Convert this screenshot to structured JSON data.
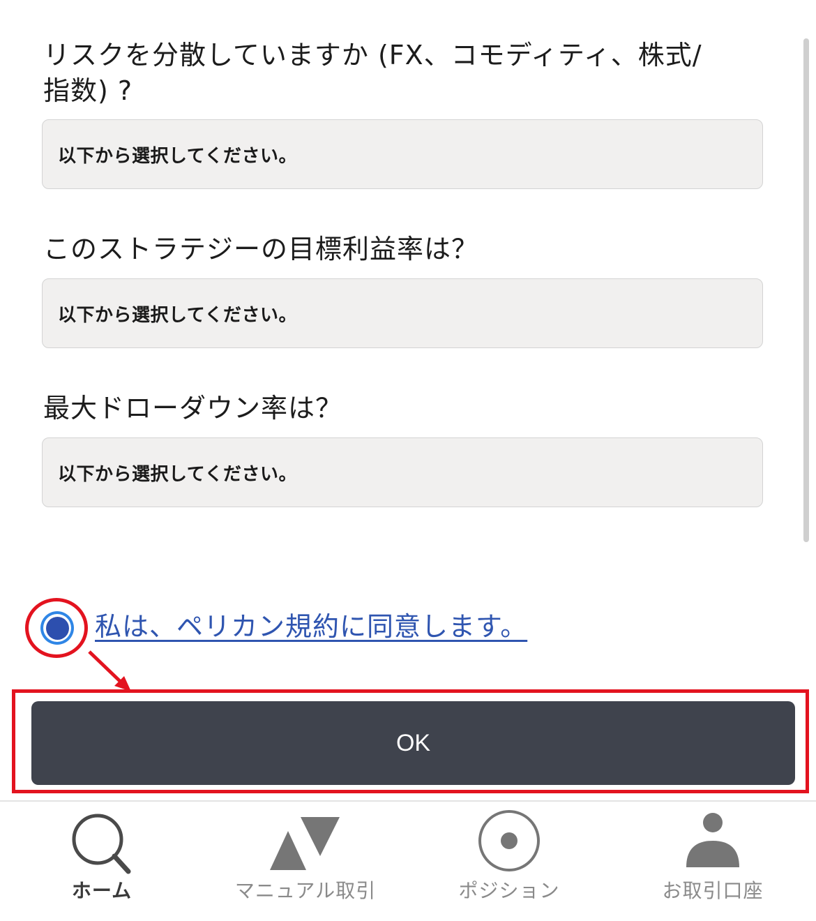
{
  "questions": [
    {
      "label": "リスクを分散していますか (FX、コモディティ、株式/指数) ?",
      "placeholder": "以下から選択してください。"
    },
    {
      "label": "このストラテジーの目標利益率は？",
      "placeholder": "以下から選択してください。"
    },
    {
      "label": "最大ドローダウン率は？",
      "placeholder": "以下から選択してください。"
    }
  ],
  "agreement": {
    "text": "私は、ペリカン規約に同意します。",
    "checked": true
  },
  "ok_button": {
    "label": "OK"
  },
  "tabs": [
    {
      "label": "ホーム",
      "icon": "search-icon",
      "active": true
    },
    {
      "label": "マニュアル取引",
      "icon": "up-down-triangles-icon",
      "active": false
    },
    {
      "label": "ポジション",
      "icon": "target-circle-icon",
      "active": false
    },
    {
      "label": "お取引口座",
      "icon": "person-icon",
      "active": false
    }
  ],
  "colors": {
    "button_bg": "#3f434d",
    "link": "#2f55b0",
    "highlight": "#e3131f",
    "radio": "#2d4fae"
  }
}
